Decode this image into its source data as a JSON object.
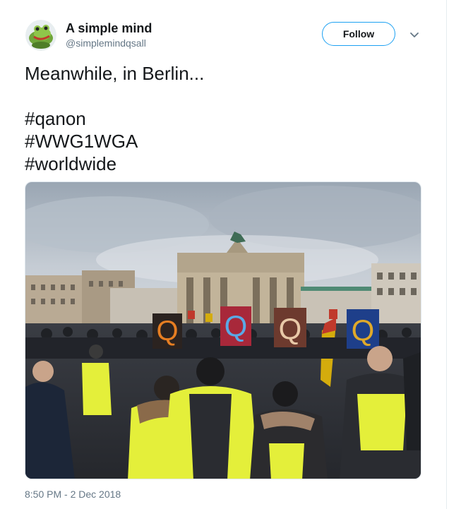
{
  "author": {
    "display_name": "A simple mind",
    "handle": "@simplemindqsall",
    "avatar_icon": "frog-avatar-icon"
  },
  "actions": {
    "follow_label": "Follow",
    "more_icon": "chevron-down-icon"
  },
  "tweet": {
    "text_line_1": "Meanwhile, in Berlin...",
    "hashtag_1": "#qanon",
    "hashtag_2": "#WWG1WGA",
    "hashtag_3": "#worldwide",
    "timestamp": "8:50 PM - 2 Dec 2018"
  },
  "media": {
    "description": "photo",
    "sign_letter": "Q"
  },
  "colors": {
    "accent": "#1da1f2",
    "text": "#14171a",
    "muted": "#657786",
    "vest": "#e4ef3a"
  }
}
